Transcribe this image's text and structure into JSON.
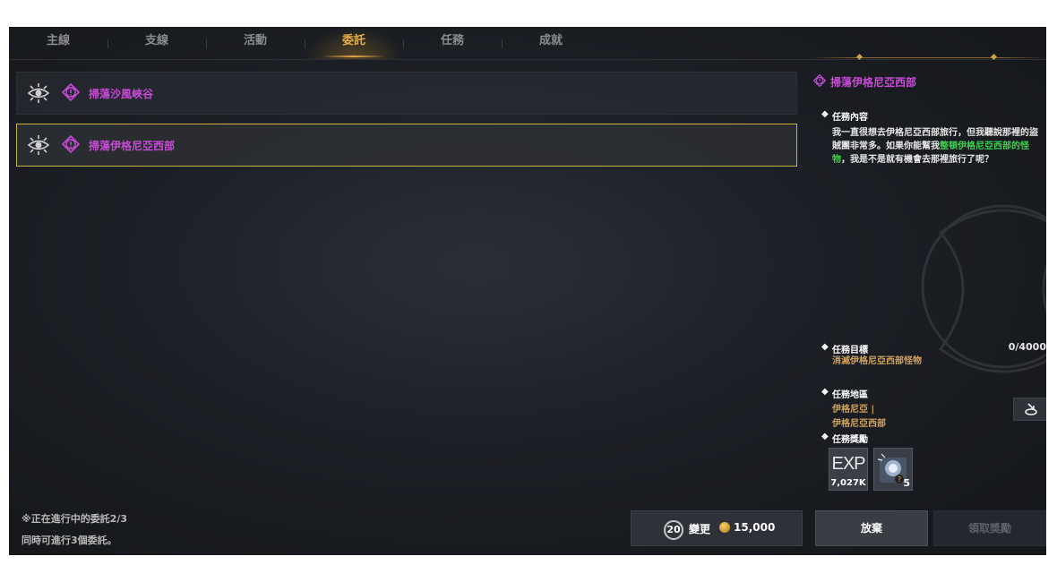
{
  "tabs": [
    {
      "label": "主線",
      "active": false
    },
    {
      "label": "支線",
      "active": false
    },
    {
      "label": "活動",
      "active": false
    },
    {
      "label": "委託",
      "active": true
    },
    {
      "label": "任務",
      "active": false
    },
    {
      "label": "成就",
      "active": false
    }
  ],
  "quests": [
    {
      "name": "掃蕩沙風峽谷",
      "selected": false,
      "icon": "eye-icon"
    },
    {
      "name": "掃蕩伊格尼亞西部",
      "selected": true,
      "icon": "eye-icon"
    }
  ],
  "detail": {
    "title": "掃蕩伊格尼亞西部",
    "content_label": "任務內容",
    "description_part1": "我一直很想去伊格尼亞西部旅行，但我聽說那裡的盜賊團非常多。如果你能幫我",
    "description_highlight": "整頓伊格尼亞西部的怪物",
    "description_part2": "，我是不是就有機會去那裡旅行了呢？",
    "goal_label": "任務目標",
    "goal_text": "消滅伊格尼亞西部怪物",
    "goal_progress": "0/4000",
    "area_label": "任務地區",
    "area_line1": "伊格尼亞 |",
    "area_line2": "伊格尼亞西部",
    "reward_label": "任務獎勵",
    "reward_exp_label": "EXP",
    "reward_exp_amount": "7,027K",
    "reward_item_count": "5"
  },
  "footer": {
    "note_line1": "※正在進行中的委託2/3",
    "note_line2": "同時可進行3個委託。",
    "change_count": "20",
    "change_label": "變更",
    "change_cost": "15,000",
    "abandon_label": "放棄",
    "claim_label": "領取獎勵"
  },
  "colors": {
    "quest_name": "#c84ad8",
    "highlight": "#3ad24a",
    "gold_text": "#d2a25a",
    "selected_border": "#c8b440",
    "active_tab": "#e8b44a"
  }
}
